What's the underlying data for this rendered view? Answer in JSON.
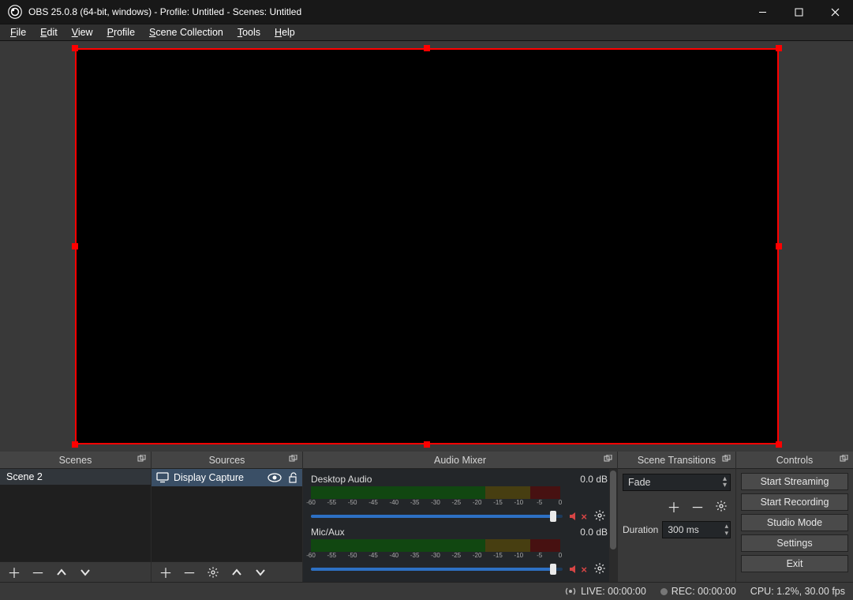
{
  "titlebar": {
    "title": "OBS 25.0.8 (64-bit, windows) - Profile: Untitled - Scenes: Untitled"
  },
  "menu": {
    "file": "File",
    "edit": "Edit",
    "view": "View",
    "profile": "Profile",
    "scene_collection": "Scene Collection",
    "tools": "Tools",
    "help": "Help"
  },
  "docks": {
    "scenes": "Scenes",
    "sources": "Sources",
    "mixer": "Audio Mixer",
    "transitions": "Scene Transitions",
    "controls": "Controls"
  },
  "scenes": {
    "items": [
      "Scene 2"
    ]
  },
  "sources": {
    "items": [
      {
        "name": "Display Capture"
      }
    ]
  },
  "mixer": {
    "scale": [
      "-60",
      "-55",
      "-50",
      "-45",
      "-40",
      "-35",
      "-30",
      "-25",
      "-20",
      "-15",
      "-10",
      "-5",
      "0"
    ],
    "channels": [
      {
        "name": "Desktop Audio",
        "level": "0.0 dB",
        "slider_pct": 96
      },
      {
        "name": "Mic/Aux",
        "level": "0.0 dB",
        "slider_pct": 96
      }
    ]
  },
  "transitions": {
    "selected": "Fade",
    "duration_label": "Duration",
    "duration_value": "300 ms"
  },
  "controls": {
    "start_streaming": "Start Streaming",
    "start_recording": "Start Recording",
    "studio_mode": "Studio Mode",
    "settings": "Settings",
    "exit": "Exit"
  },
  "status": {
    "live": "LIVE: 00:00:00",
    "rec": "REC: 00:00:00",
    "cpu": "CPU: 1.2%, 30.00 fps"
  }
}
